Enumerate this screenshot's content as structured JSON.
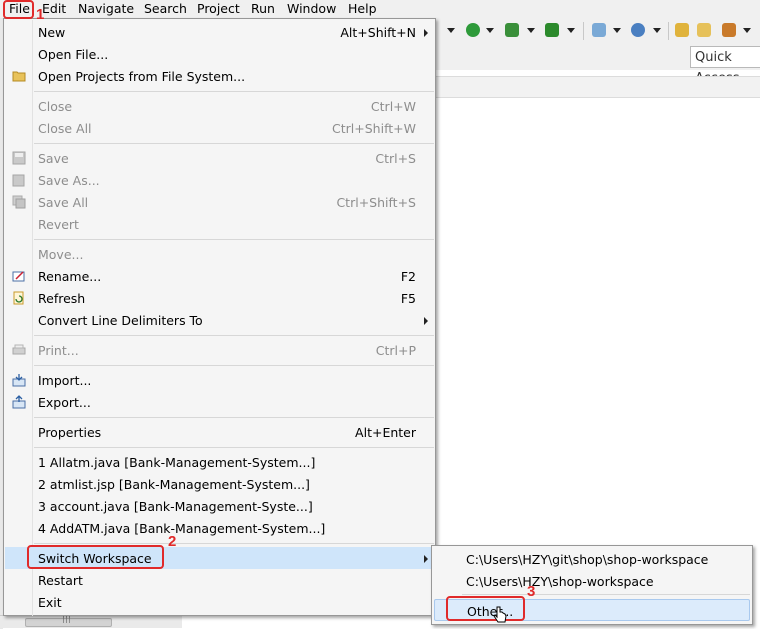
{
  "menubar": {
    "items": [
      "File",
      "Edit",
      "Navigate",
      "Search",
      "Project",
      "Run",
      "Window",
      "Help"
    ]
  },
  "toolbar": {
    "quick_access_placeholder": "Quick Access"
  },
  "file_menu": {
    "items": [
      {
        "label": "New",
        "shortcut": "Alt+Shift+N"
      },
      {
        "label": "Open File..."
      },
      {
        "label": "Open Projects from File System..."
      },
      {
        "label": "Close",
        "shortcut": "Ctrl+W"
      },
      {
        "label": "Close All",
        "shortcut": "Ctrl+Shift+W"
      },
      {
        "label": "Save",
        "shortcut": "Ctrl+S"
      },
      {
        "label": "Save As..."
      },
      {
        "label": "Save All",
        "shortcut": "Ctrl+Shift+S"
      },
      {
        "label": "Revert"
      },
      {
        "label": "Move..."
      },
      {
        "label": "Rename...",
        "shortcut": "F2"
      },
      {
        "label": "Refresh",
        "shortcut": "F5"
      },
      {
        "label": "Convert Line Delimiters To"
      },
      {
        "label": "Print...",
        "shortcut": "Ctrl+P"
      },
      {
        "label": "Import..."
      },
      {
        "label": "Export..."
      },
      {
        "label": "Properties",
        "shortcut": "Alt+Enter"
      },
      {
        "label": "1 Allatm.java  [Bank-Management-System...]"
      },
      {
        "label": "2 atmlist.jsp  [Bank-Management-System...]"
      },
      {
        "label": "3 account.java  [Bank-Management-Syste...]"
      },
      {
        "label": "4 AddATM.java  [Bank-Management-System...]"
      },
      {
        "label": "Switch Workspace"
      },
      {
        "label": "Restart"
      },
      {
        "label": "Exit"
      }
    ]
  },
  "switch_workspace_submenu": {
    "items": [
      {
        "label": "C:\\Users\\HZY\\git\\shop\\shop-workspace"
      },
      {
        "label": "C:\\Users\\HZY\\shop-workspace"
      },
      {
        "label": "Other..."
      }
    ]
  },
  "annotations": {
    "step1": "1",
    "step2": "2",
    "step3": "3",
    "color": "#e02a2a"
  }
}
